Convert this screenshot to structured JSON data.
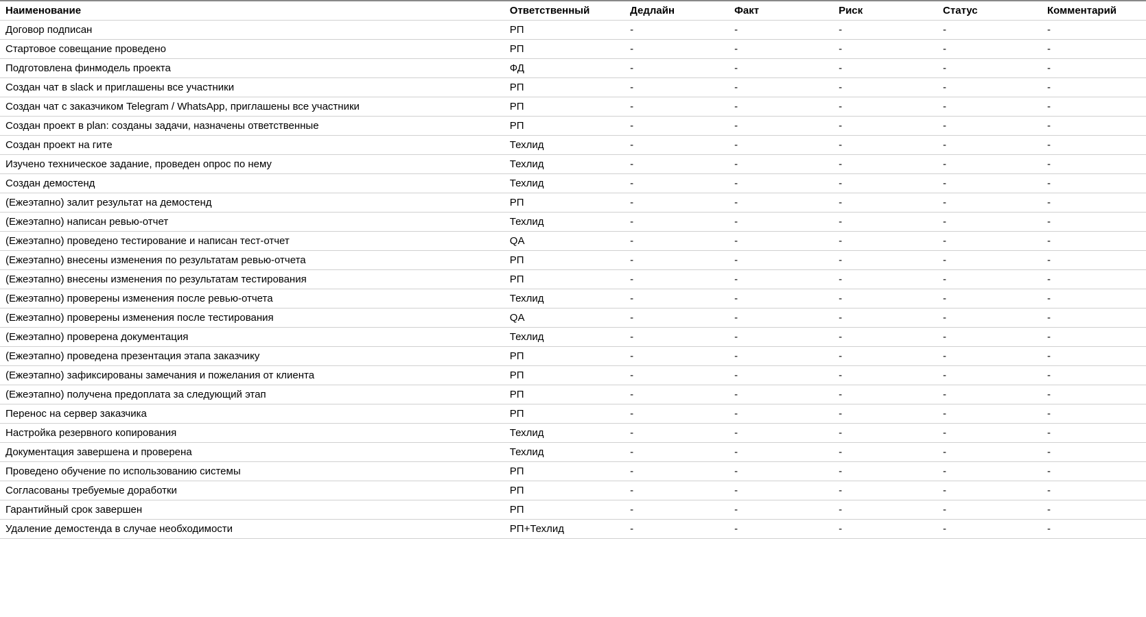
{
  "table": {
    "headers": {
      "name": "Наименование",
      "responsible": "Ответственный",
      "deadline": "Дедлайн",
      "fact": "Факт",
      "risk": "Риск",
      "status": "Статус",
      "comment": "Комментарий"
    },
    "rows": [
      {
        "name": "Договор подписан",
        "responsible": "РП",
        "deadline": "-",
        "fact": "-",
        "risk": "-",
        "status": "-",
        "comment": "-"
      },
      {
        "name": "Стартовое совещание проведено",
        "responsible": "РП",
        "deadline": "-",
        "fact": "-",
        "risk": "-",
        "status": "-",
        "comment": "-"
      },
      {
        "name": "Подготовлена финмодель проекта",
        "responsible": "ФД",
        "deadline": "-",
        "fact": "-",
        "risk": "-",
        "status": "-",
        "comment": "-"
      },
      {
        "name": "Создан чат в slack и приглашены все участники",
        "responsible": "РП",
        "deadline": "-",
        "fact": "-",
        "risk": "-",
        "status": "-",
        "comment": "-"
      },
      {
        "name": "Создан чат с заказчиком Telegram / WhatsApp, приглашены все участники",
        "responsible": "РП",
        "deadline": "-",
        "fact": "-",
        "risk": "-",
        "status": "-",
        "comment": "-"
      },
      {
        "name": "Создан проект в plan: созданы задачи, назначены ответственные",
        "responsible": "РП",
        "deadline": "-",
        "fact": "-",
        "risk": "-",
        "status": "-",
        "comment": "-"
      },
      {
        "name": "Создан проект на гите",
        "responsible": "Техлид",
        "deadline": "-",
        "fact": "-",
        "risk": "-",
        "status": "-",
        "comment": "-"
      },
      {
        "name": "Изучено техническое задание, проведен опрос по нему",
        "responsible": "Техлид",
        "deadline": "-",
        "fact": "-",
        "risk": "-",
        "status": "-",
        "comment": "-"
      },
      {
        "name": "Создан демостенд",
        "responsible": "Техлид",
        "deadline": "-",
        "fact": "-",
        "risk": "-",
        "status": "-",
        "comment": "-"
      },
      {
        "name": "(Ежеэтапно) залит результат на демостенд",
        "responsible": "РП",
        "deadline": "-",
        "fact": "-",
        "risk": "-",
        "status": "-",
        "comment": "-"
      },
      {
        "name": "(Ежеэтапно) написан ревью-отчет",
        "responsible": "Техлид",
        "deadline": "-",
        "fact": "-",
        "risk": "-",
        "status": "-",
        "comment": "-"
      },
      {
        "name": "(Ежеэтапно) проведено тестирование и написан тест-отчет",
        "responsible": "QA",
        "deadline": "-",
        "fact": "-",
        "risk": "-",
        "status": "-",
        "comment": "-"
      },
      {
        "name": "(Ежеэтапно) внесены изменения по результатам ревью-отчета",
        "responsible": "РП",
        "deadline": "-",
        "fact": "-",
        "risk": "-",
        "status": "-",
        "comment": "-"
      },
      {
        "name": "(Ежеэтапно) внесены изменения по результатам тестирования",
        "responsible": "РП",
        "deadline": "-",
        "fact": "-",
        "risk": "-",
        "status": "-",
        "comment": "-"
      },
      {
        "name": "(Ежеэтапно) проверены изменения после ревью-отчета",
        "responsible": "Техлид",
        "deadline": "-",
        "fact": "-",
        "risk": "-",
        "status": "-",
        "comment": "-"
      },
      {
        "name": "(Ежеэтапно) проверены изменения после тестирования",
        "responsible": "QA",
        "deadline": "-",
        "fact": "-",
        "risk": "-",
        "status": "-",
        "comment": "-"
      },
      {
        "name": "(Ежеэтапно) проверена документация",
        "responsible": "Техлид",
        "deadline": "-",
        "fact": "-",
        "risk": "-",
        "status": "-",
        "comment": "-"
      },
      {
        "name": "(Ежеэтапно) проведена презентация этапа заказчику",
        "responsible": "РП",
        "deadline": "-",
        "fact": "-",
        "risk": "-",
        "status": "-",
        "comment": "-"
      },
      {
        "name": "(Ежеэтапно) зафиксированы замечания и пожелания от клиента",
        "responsible": "РП",
        "deadline": "-",
        "fact": "-",
        "risk": "-",
        "status": "-",
        "comment": "-"
      },
      {
        "name": "(Ежеэтапно) получена предоплата за следующий этап",
        "responsible": "РП",
        "deadline": "-",
        "fact": "-",
        "risk": "-",
        "status": "-",
        "comment": "-"
      },
      {
        "name": "Перенос на сервер заказчика",
        "responsible": "РП",
        "deadline": "-",
        "fact": "-",
        "risk": "-",
        "status": "-",
        "comment": "-"
      },
      {
        "name": "Настройка резервного копирования",
        "responsible": "Техлид",
        "deadline": "-",
        "fact": "-",
        "risk": "-",
        "status": "-",
        "comment": "-"
      },
      {
        "name": "Документация завершена и проверена",
        "responsible": "Техлид",
        "deadline": "-",
        "fact": "-",
        "risk": "-",
        "status": "-",
        "comment": "-"
      },
      {
        "name": "Проведено обучение по использованию системы",
        "responsible": "РП",
        "deadline": "-",
        "fact": "-",
        "risk": "-",
        "status": "-",
        "comment": "-"
      },
      {
        "name": "Согласованы требуемые доработки",
        "responsible": "РП",
        "deadline": "-",
        "fact": "-",
        "risk": "-",
        "status": "-",
        "comment": "-"
      },
      {
        "name": "Гарантийный срок завершен",
        "responsible": "РП",
        "deadline": "-",
        "fact": "-",
        "risk": "-",
        "status": "-",
        "comment": "-"
      },
      {
        "name": "Удаление демостенда в случае необходимости",
        "responsible": "РП+Техлид",
        "deadline": "-",
        "fact": "-",
        "risk": "-",
        "status": "-",
        "comment": "-"
      }
    ]
  }
}
